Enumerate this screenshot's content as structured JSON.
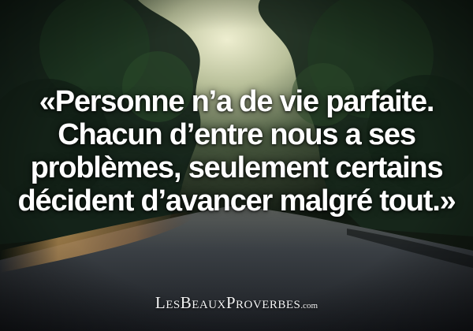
{
  "quote": {
    "line1": "«Personne n’a de vie parfaite.",
    "line2": "Chacun d’entre nous a ses",
    "line3": "problèmes, seulement certains",
    "line4": "décident d’avancer malgré tout.»"
  },
  "watermark": {
    "name": "LesBeauxProverbes",
    "domain": ".com"
  },
  "colors": {
    "text": "#ffffff",
    "sky": "#d8d8b0",
    "foliage": "#1e3220",
    "road": "#2a2f34",
    "sunlight": "#c79a58"
  }
}
